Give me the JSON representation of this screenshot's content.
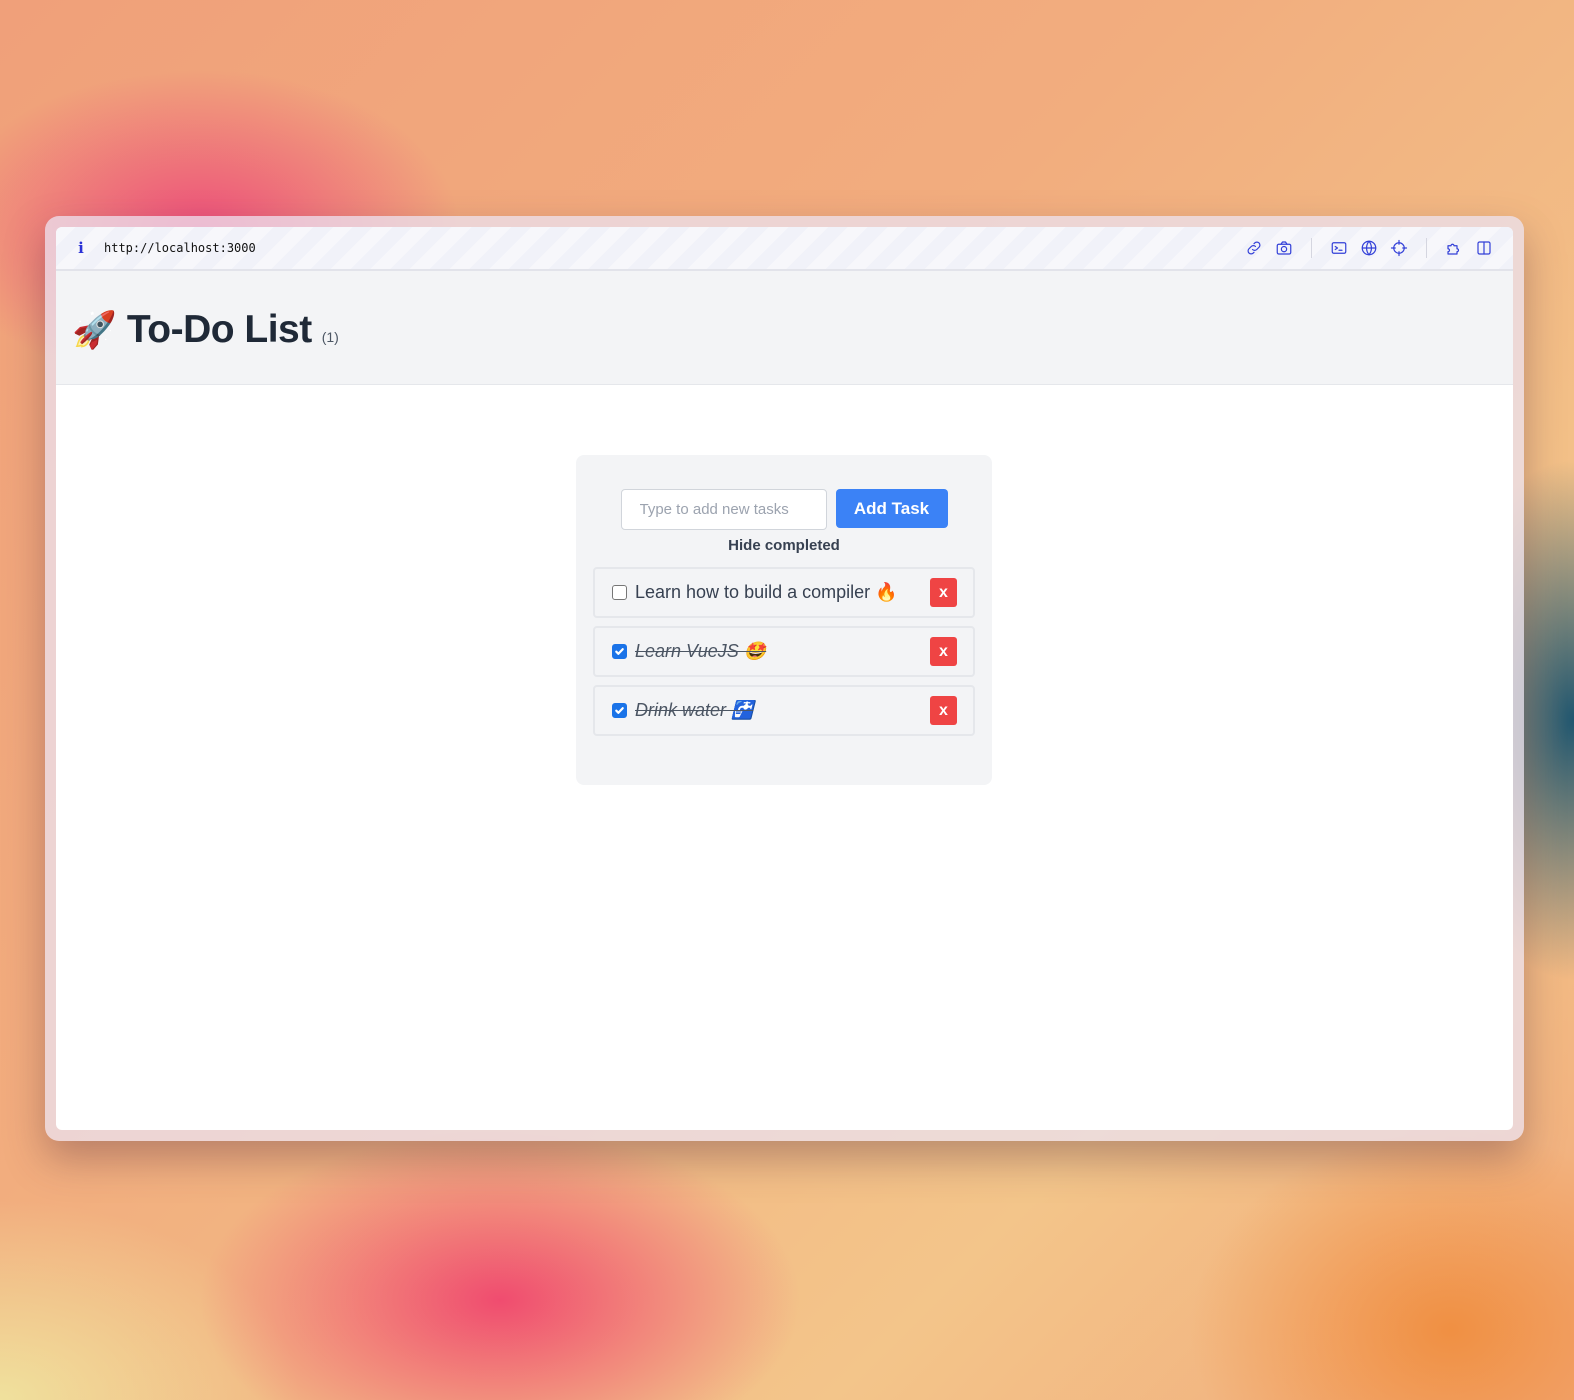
{
  "browser": {
    "url": "http://localhost:3000",
    "info_glyph": "i",
    "tools": [
      "link-icon",
      "camera-icon",
      "terminal-icon",
      "globe-icon",
      "crosshair-icon",
      "puzzle-icon",
      "split-view-icon"
    ]
  },
  "header": {
    "icon": "🚀",
    "title": "To-Do List",
    "count": "(1)"
  },
  "form": {
    "placeholder": "Type to add new tasks",
    "add_label": "Add Task",
    "hide_completed_label": "Hide completed"
  },
  "tasks": [
    {
      "label": "Learn how to build a compiler 🔥",
      "completed": false,
      "delete_label": "x"
    },
    {
      "label": "Learn VueJS 🤩",
      "completed": true,
      "delete_label": "x"
    },
    {
      "label": "Drink water 🚰",
      "completed": true,
      "delete_label": "x"
    }
  ],
  "colors": {
    "accent": "#3b82f6",
    "danger": "#ef4444",
    "title": "#1f2937"
  }
}
